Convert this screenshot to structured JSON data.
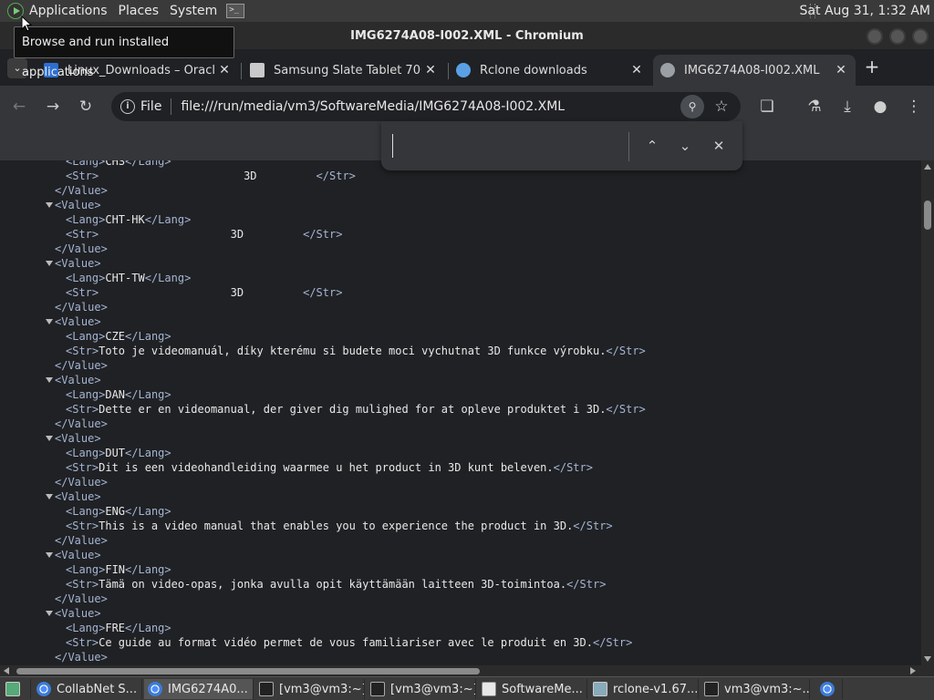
{
  "top_panel": {
    "menu_applications": "Applications",
    "menu_places": "Places",
    "menu_system": "System",
    "clock": "Sat Aug 31,  1:32 AM"
  },
  "tooltip": "Browse and run installed applications",
  "window": {
    "title": "IMG6274A08-I002.XML - Chromium"
  },
  "tabs": [
    {
      "title": "Linux_Downloads – Oracle",
      "favicon_color": "#2d6fd1"
    },
    {
      "title": "Samsung Slate Tablet 700",
      "favicon_color": "#c9c9c9"
    },
    {
      "title": "Rclone downloads",
      "favicon_color": "#5aa0e6"
    },
    {
      "title": "IMG6274A08-I002.XML",
      "favicon_color": "#9aa0a6"
    }
  ],
  "toolbar": {
    "scheme_label": "File",
    "url": "file:///run/media/vm3/SoftwareMedia/IMG6274A08-I002.XML"
  },
  "find": {
    "query": ""
  },
  "xml_lines": [
    {
      "type": "lang",
      "value": "CHS"
    },
    {
      "type": "str",
      "value": "                      3D         "
    },
    {
      "type": "close"
    },
    {
      "type": "open"
    },
    {
      "type": "lang",
      "value": "CHT-HK"
    },
    {
      "type": "str",
      "value": "                    3D         "
    },
    {
      "type": "close"
    },
    {
      "type": "open"
    },
    {
      "type": "lang",
      "value": "CHT-TW"
    },
    {
      "type": "str",
      "value": "                    3D         "
    },
    {
      "type": "close"
    },
    {
      "type": "open"
    },
    {
      "type": "lang",
      "value": "CZE"
    },
    {
      "type": "str",
      "value": "Toto je videomanuál, díky kterému si budete moci vychutnat 3D funkce výrobku."
    },
    {
      "type": "close"
    },
    {
      "type": "open"
    },
    {
      "type": "lang",
      "value": "DAN"
    },
    {
      "type": "str",
      "value": "Dette er en videomanual, der giver dig mulighed for at opleve produktet i 3D."
    },
    {
      "type": "close"
    },
    {
      "type": "open"
    },
    {
      "type": "lang",
      "value": "DUT"
    },
    {
      "type": "str",
      "value": "Dit is een videohandleiding waarmee u het product in 3D kunt beleven."
    },
    {
      "type": "close"
    },
    {
      "type": "open"
    },
    {
      "type": "lang",
      "value": "ENG"
    },
    {
      "type": "str",
      "value": "This is a video manual that enables you to experience the product in 3D."
    },
    {
      "type": "close"
    },
    {
      "type": "open"
    },
    {
      "type": "lang",
      "value": "FIN"
    },
    {
      "type": "str",
      "value": "Tämä on video-opas, jonka avulla opit käyttämään laitteen 3D-toimintoa."
    },
    {
      "type": "close"
    },
    {
      "type": "open"
    },
    {
      "type": "lang",
      "value": "FRE"
    },
    {
      "type": "str",
      "value": "Ce guide au format vidéo permet de vous familiariser avec le produit en 3D."
    },
    {
      "type": "close"
    }
  ],
  "taskbar": [
    {
      "label": "CollabNet S...",
      "icon": "chrome"
    },
    {
      "label": "IMG6274A0...",
      "icon": "chrome"
    },
    {
      "label": "[vm3@vm3:~]",
      "icon": "term"
    },
    {
      "label": "[vm3@vm3:~]",
      "icon": "term"
    },
    {
      "label": "SoftwareMe...",
      "icon": "folder"
    },
    {
      "label": "rclone-v1.67...",
      "icon": "pkg"
    },
    {
      "label": "vm3@vm3:~...",
      "icon": "term"
    }
  ]
}
